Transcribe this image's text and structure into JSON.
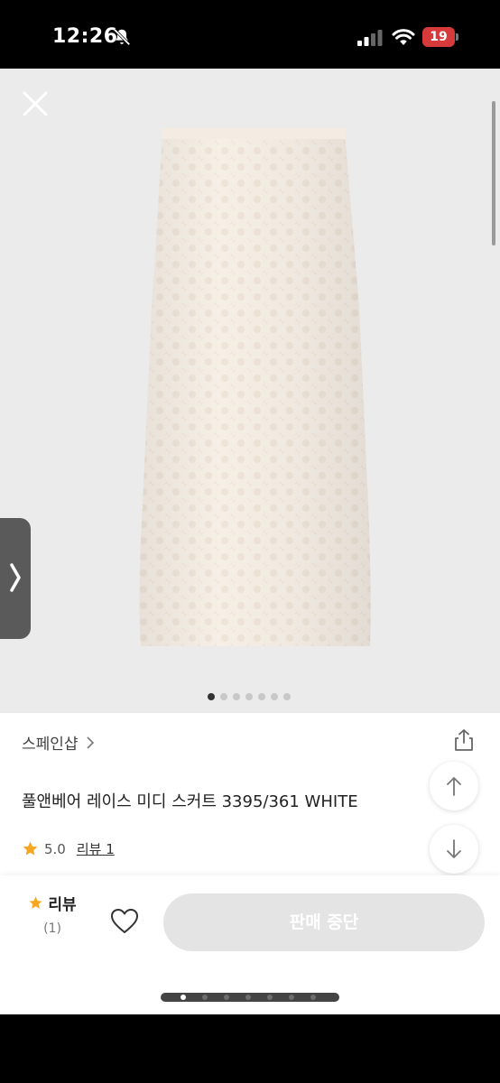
{
  "status_bar": {
    "time": "12:26",
    "battery_level": "19",
    "battery_color": "#d63a3a"
  },
  "gallery": {
    "image_count": 7,
    "active_index": 0
  },
  "product": {
    "shop_name": "스페인샵",
    "title": "풀앤베어 레이스 미디 스커트 3395/361 WHITE",
    "rating": "5.0",
    "review_link": "리뷰 1"
  },
  "bottom_bar": {
    "review_label": "리뷰",
    "review_count": "(1)",
    "sale_button_label": "판매 중단"
  },
  "colors": {
    "accent_star": "#f5a623",
    "pink_accent": "#ec6f97",
    "disabled_button": "#e4e4e4"
  }
}
